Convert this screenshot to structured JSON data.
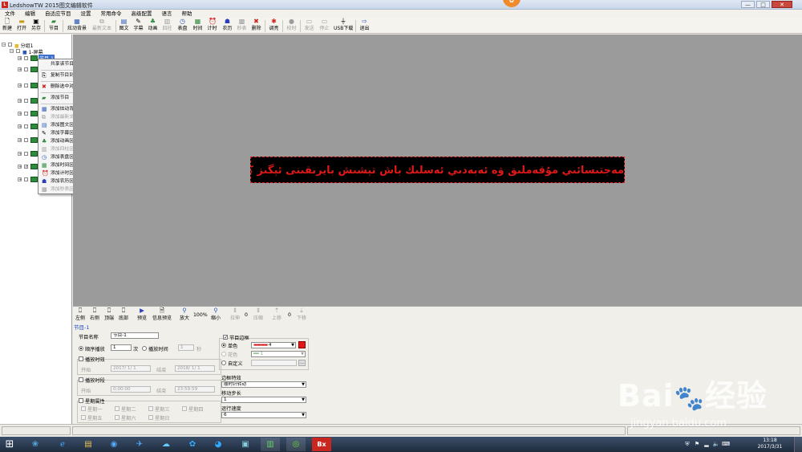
{
  "window": {
    "title": "LedshowTW 2015图文编辑软件",
    "app_icon": "ledshow-logo-icon",
    "min": "—",
    "max": "□",
    "close": "✕",
    "badge": ""
  },
  "menu": [
    "文件",
    "编辑",
    "自适应节目",
    "设置",
    "常用命令",
    "高级配置",
    "语言",
    "帮助"
  ],
  "toolbar": [
    {
      "label": "新建",
      "icon": "new-icon",
      "enabled": true
    },
    {
      "label": "打开",
      "icon": "open-icon",
      "enabled": true
    },
    {
      "label": "另存",
      "icon": "saveas-icon",
      "enabled": true
    },
    {
      "label": "节目",
      "icon": "program-icon",
      "enabled": true
    },
    {
      "label": "炫动背景",
      "icon": "background-icon",
      "enabled": true
    },
    {
      "label": "最新文本",
      "icon": "text-icon",
      "enabled": false
    },
    {
      "label": "图文",
      "icon": "image-text-icon",
      "enabled": true
    },
    {
      "label": "字幕",
      "icon": "subtitle-icon",
      "enabled": true
    },
    {
      "label": "动画",
      "icon": "animation-icon",
      "enabled": true
    },
    {
      "label": "四柱",
      "icon": "pillars-icon",
      "enabled": false
    },
    {
      "label": "表盘",
      "icon": "dial-icon",
      "enabled": true
    },
    {
      "label": "时间",
      "icon": "time-icon",
      "enabled": true
    },
    {
      "label": "计时",
      "icon": "timer-icon",
      "enabled": true
    },
    {
      "label": "农历",
      "icon": "lunar-icon",
      "enabled": true
    },
    {
      "label": "秒表",
      "icon": "stopwatch-icon",
      "enabled": false
    },
    {
      "label": "删除",
      "icon": "delete-icon",
      "enabled": true
    },
    {
      "label": "调亮",
      "icon": "brightness-icon",
      "enabled": true
    },
    {
      "label": "校时",
      "icon": "sync-time-icon",
      "enabled": false
    },
    {
      "label": "发送",
      "icon": "send-icon",
      "enabled": false
    },
    {
      "label": "停止",
      "icon": "stop-icon",
      "enabled": false
    },
    {
      "label": "USB下载",
      "icon": "usb-icon",
      "enabled": true
    },
    {
      "label": "退出",
      "icon": "exit-icon",
      "enabled": true
    }
  ],
  "tree": {
    "root": "分组1",
    "screen": "1-屏幕",
    "program": "节目-1"
  },
  "context_menu": [
    {
      "label": "共享该节目",
      "icon": "",
      "enabled": true
    },
    {
      "label": "复制节目到...",
      "icon": "copy-icon",
      "enabled": true
    },
    {
      "label": "删除选中对象",
      "icon": "delete-icon",
      "enabled": true
    },
    {
      "label": "添加节目",
      "icon": "program-icon",
      "enabled": true
    },
    {
      "label": "添加炫动背景区域",
      "icon": "background-icon",
      "enabled": true
    },
    {
      "label": "添加最新文本区域",
      "icon": "text-icon",
      "enabled": false
    },
    {
      "label": "添加图文区域",
      "icon": "image-text-icon",
      "enabled": true
    },
    {
      "label": "添加字幕区域",
      "icon": "subtitle-icon",
      "enabled": true
    },
    {
      "label": "添加动画区域",
      "icon": "animation-icon",
      "enabled": true
    },
    {
      "label": "添加四柱区域",
      "icon": "pillars-icon",
      "enabled": false
    },
    {
      "label": "添加表盘区域",
      "icon": "dial-icon",
      "enabled": true
    },
    {
      "label": "添加时间区域",
      "icon": "time-icon",
      "enabled": true
    },
    {
      "label": "添加计时区域",
      "icon": "timer-icon",
      "enabled": true
    },
    {
      "label": "添加农历区域",
      "icon": "lunar-icon",
      "enabled": true
    },
    {
      "label": "添加秒表区域",
      "icon": "stopwatch-icon",
      "enabled": false
    }
  ],
  "led_text": "ﻣﻪﺟﺘﯩﺴﺎﺋﯩﻲ ﻣﯘﻗﻪﻣﻠﯩﻖ ﯞﻩ ﺋﻪﺑﻪﺩﯨﻲ ﺋﻪﺳﻠﯩﻚ ﺑﺎﺵ ﺗﯧﺸﯩﺶ ﺑﺎﻳﺮﯨﻘﯩﻨﻰ ﺋﯧﮕﯩﺰ ﻛﯚﺗﯜﺭﻩﻳﻠﻰ",
  "edit_toolbar": [
    {
      "label": "左侧",
      "icon": "align-left-icon",
      "enabled": true
    },
    {
      "label": "右侧",
      "icon": "align-right-icon",
      "enabled": true
    },
    {
      "label": "顶端",
      "icon": "align-top-icon",
      "enabled": true
    },
    {
      "label": "底部",
      "icon": "align-bottom-icon",
      "enabled": true
    },
    {
      "label": "预览",
      "icon": "play-icon",
      "enabled": true
    },
    {
      "label": "信息预览",
      "icon": "info-preview-icon",
      "enabled": true
    },
    {
      "label": "放大",
      "icon": "zoom-in-icon",
      "enabled": true
    },
    {
      "label": "缩小",
      "icon": "zoom-out-icon",
      "enabled": true
    },
    {
      "label": "拉伸",
      "icon": "stretch-icon",
      "enabled": false
    },
    {
      "label": "压缩",
      "icon": "compress-icon",
      "enabled": false
    },
    {
      "label": "上移",
      "icon": "move-up-icon",
      "enabled": false
    },
    {
      "label": "下移",
      "icon": "move-down-icon",
      "enabled": false
    }
  ],
  "zoom": "100%",
  "stretch_value": "0",
  "updown_value": "0",
  "props": {
    "section_title": "节目-1",
    "name_label": "节目名称",
    "name_value": "节目-1",
    "play_order_label": "顺序播放",
    "play_count": "1",
    "count_unit": "次",
    "play_time_label": "播放时间",
    "play_time_value": "1",
    "seconds_unit": "秒",
    "timed_play_label": "播放时效",
    "start_label": "开始",
    "start_date": "2017/ 1/ 1",
    "end_label": "结束",
    "end_date": "2018/ 1/ 1",
    "time_period_label": "播放时段",
    "start_time": "0:00:00",
    "end_time": "23:59:59",
    "weekday_label": "星期属性",
    "weekdays": [
      "星期一",
      "星期二",
      "星期三",
      "星期四",
      "星期五",
      "星期六",
      "星期日"
    ],
    "border_label": "节目边框",
    "single_color_label": "单色",
    "flowery_label": "花色",
    "custom_label": "自定义",
    "border_value_1": "4",
    "border_value_2": "1",
    "border_effect_label": "边框特效",
    "border_effect_value": "顺时针转动",
    "move_step_label": "移动步长",
    "move_step_value": "1",
    "speed_label": "运行速度",
    "speed_value": "6",
    "border_color": "#e01818"
  },
  "taskbar": {
    "icons": [
      "windows-start-icon",
      "wps-icon",
      "ie-icon",
      "explorer-icon",
      "media-icon",
      "feather-icon",
      "cloud-icon",
      "baidu-netdisk-icon",
      "fish-icon",
      "monitor-icon",
      "ledshow-icon",
      "bx-icon"
    ],
    "time": "13:18",
    "date": "2017/3/31"
  },
  "watermark": {
    "logo": "Bai",
    "logo2": "经验",
    "url": "jingyan.baidu.com"
  }
}
